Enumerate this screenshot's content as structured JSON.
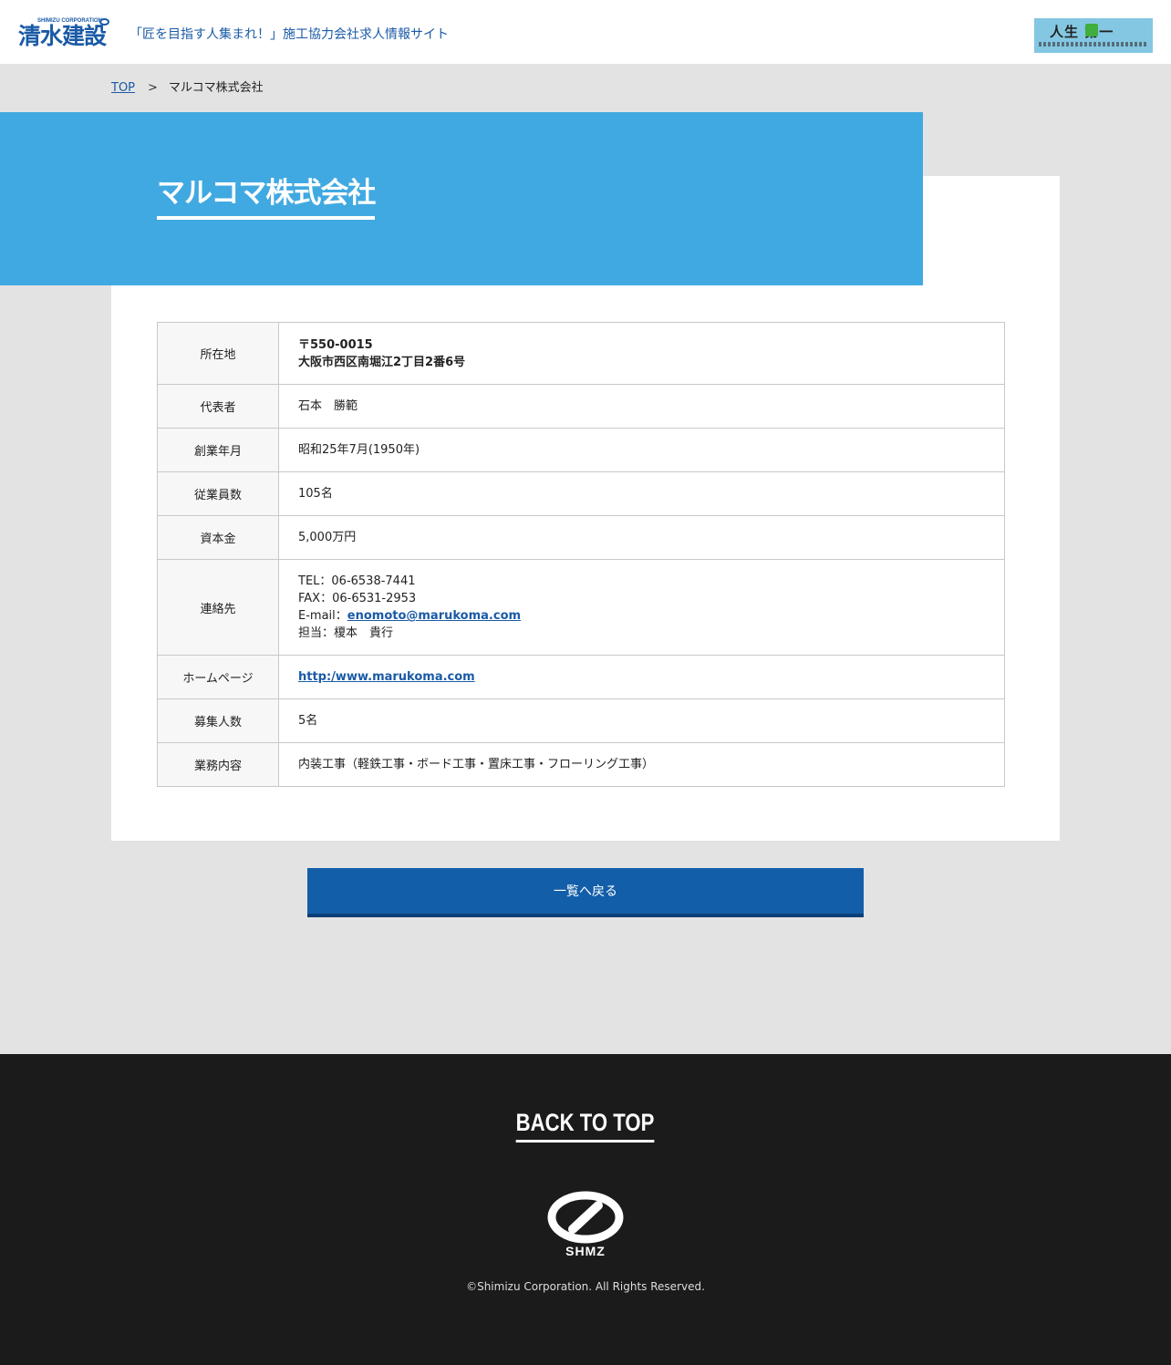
{
  "header": {
    "logo_small": "SHIMIZU CORPORATION",
    "logo_main": "清水建設",
    "tagline": "「匠を目指す人集まれ！」施工協力会社求人情報サイト",
    "banner_main": "人生  第一"
  },
  "breadcrumb": {
    "top": "TOP",
    "separator": ">",
    "current": "マルコマ株式会社"
  },
  "company": {
    "name": "マルコマ株式会社"
  },
  "table": {
    "address_label": "所在地",
    "address_zip": "〒550-0015",
    "address_line": "大阪市西区南堀江2丁目2番6号",
    "rep_label": "代表者",
    "rep_value": "石本　勝範",
    "founded_label": "創業年月",
    "founded_value": "昭和25年7月(1950年)",
    "employees_label": "従業員数",
    "employees_value": "105名",
    "capital_label": "資本金",
    "capital_value": "5,000万円",
    "contact_label": "連絡先",
    "contact_tel": "TEL：06-6538-7441",
    "contact_fax": "FAX：06-6531-2953",
    "contact_email_prefix": "E-mail：",
    "contact_email": "enomoto@marukoma.com",
    "contact_person": "担当：榎本　貴行",
    "homepage_label": "ホームページ",
    "homepage_value": "http:/www.marukoma.com",
    "recruits_label": "募集人数",
    "recruits_value": "5名",
    "business_label": "業務内容",
    "business_value": "内装工事（軽鉄工事・ボード工事・置床工事・フローリング工事）"
  },
  "back_button": "一覧へ戻る",
  "footer": {
    "back_to_top": "BACK TO TOP",
    "logo_text": "SHMZ",
    "copyright": "©Shimizu Corporation. All Rights Reserved."
  },
  "colors": {
    "brand_blue": "#1a5aa6",
    "hero_blue": "#41a9e1",
    "button_blue": "#135ea9",
    "footer_bg": "#1b1b1b",
    "page_bg": "#e3e3e3"
  }
}
